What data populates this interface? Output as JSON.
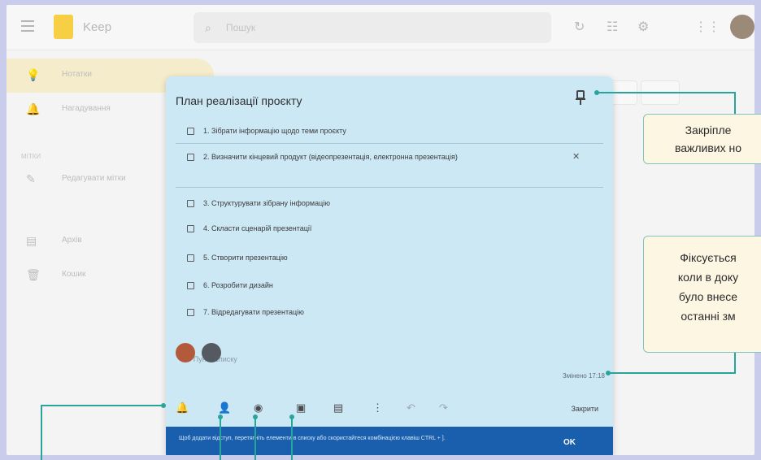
{
  "app": {
    "name": "Keep"
  },
  "search": {
    "placeholder": "Пошук"
  },
  "sidebar": {
    "items": [
      {
        "label": "Нотатки",
        "icon": "lightbulb-icon"
      },
      {
        "label": "Нагадування",
        "icon": "bell-icon"
      },
      {
        "label": "Редагувати мітки",
        "icon": "pencil-icon"
      },
      {
        "label": "Архів",
        "icon": "archive-icon"
      },
      {
        "label": "Кошик",
        "icon": "trash-icon"
      }
    ],
    "section_heading": "МІТКИ"
  },
  "note": {
    "title": "План реалізації проєкту",
    "items": [
      "1. Зібрати інформацію щодо теми проєкту",
      "2. Визначити кінцевий продукт (відеопрезентація, електронна презентація)",
      "3. Структурувати зібрану інформацію",
      "4. Скласти сценарій презентації",
      "5. Створити презентацію",
      "6. Розробити дизайн",
      "7. Відредагувати презентацію"
    ],
    "add_item": "Пункт списку",
    "edited": "Змінено 17:18",
    "close": "Закрити",
    "toolbar_icons": [
      "reminder-icon",
      "collaborator-icon",
      "palette-icon",
      "image-icon",
      "archive-icon",
      "more-icon",
      "undo-icon",
      "redo-icon"
    ]
  },
  "snackbar": {
    "text": "Щоб додати відступ, перетягніть елементи в списку або скористайтеся комбінацією клавіш CTRL + ].",
    "action": "OK"
  },
  "callouts": {
    "pin_lines": [
      "Закріпле",
      "важливих но"
    ],
    "edited_lines": [
      "Фіксується",
      "коли в доку",
      "було внесе",
      "останні зм"
    ]
  },
  "colors": {
    "note_bg": "#cde8f5",
    "accent_line": "#27a59a",
    "snackbar_bg": "#1a5fae",
    "callout_bg": "#fdf6e3"
  }
}
